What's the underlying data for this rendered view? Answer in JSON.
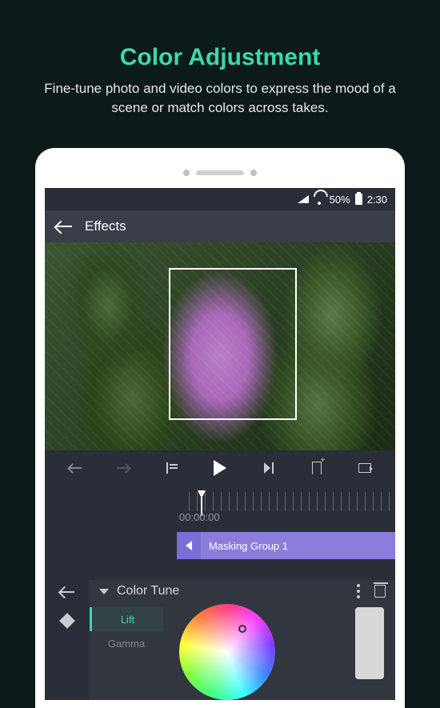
{
  "hero": {
    "title": "Color Adjustment",
    "subtitle": "Fine-tune photo and video colors to express the mood of a scene or match colors across takes."
  },
  "statusbar": {
    "battery": "50%",
    "time": "2:30"
  },
  "topbar": {
    "title": "Effects"
  },
  "timeline": {
    "timecode": "00:00:00",
    "track_label": "Masking Group 1"
  },
  "panel": {
    "title": "Color Tune",
    "tabs": {
      "lift": "Lift",
      "gamma": "Gamma"
    }
  }
}
